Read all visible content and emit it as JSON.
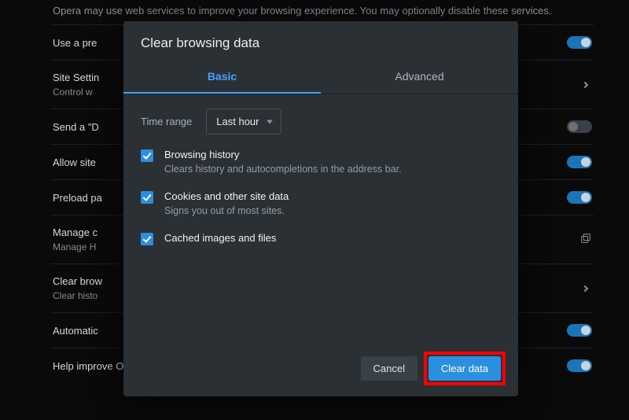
{
  "intro_text": "Opera may use web services to improve your browsing experience. You may optionally disable these services.",
  "bg_rows": [
    {
      "title": "Use a pre",
      "sub": "",
      "ctrl": "toggle",
      "on": true
    },
    {
      "title": "Site Settin",
      "sub": "Control w",
      "ctrl": "chevron"
    },
    {
      "title": "Send a \"D",
      "sub": "",
      "ctrl": "toggle",
      "on": false
    },
    {
      "title": "Allow site",
      "sub": "",
      "ctrl": "toggle",
      "on": true
    },
    {
      "title": "Preload pa",
      "sub": "",
      "ctrl": "toggle",
      "on": true
    },
    {
      "title": "Manage c",
      "sub": "Manage H",
      "ctrl": "external"
    },
    {
      "title": "Clear brow",
      "sub": "Clear histo",
      "ctrl": "chevron"
    },
    {
      "title": "Automatic",
      "sub": "",
      "ctrl": "toggle",
      "on": true
    },
    {
      "title": "Help improve Opera by sending feature usage information.  Learn more",
      "sub": "",
      "ctrl": "toggle",
      "on": true
    }
  ],
  "dialog": {
    "title": "Clear browsing data",
    "tabs": {
      "basic": "Basic",
      "advanced": "Advanced",
      "active": "basic"
    },
    "time_range_label": "Time range",
    "time_range_value": "Last hour",
    "options": [
      {
        "checked": true,
        "title": "Browsing history",
        "desc": "Clears history and autocompletions in the address bar."
      },
      {
        "checked": true,
        "title": "Cookies and other site data",
        "desc": "Signs you out of most sites."
      },
      {
        "checked": true,
        "title": "Cached images and files",
        "desc": ""
      }
    ],
    "cancel_label": "Cancel",
    "clear_label": "Clear data"
  }
}
